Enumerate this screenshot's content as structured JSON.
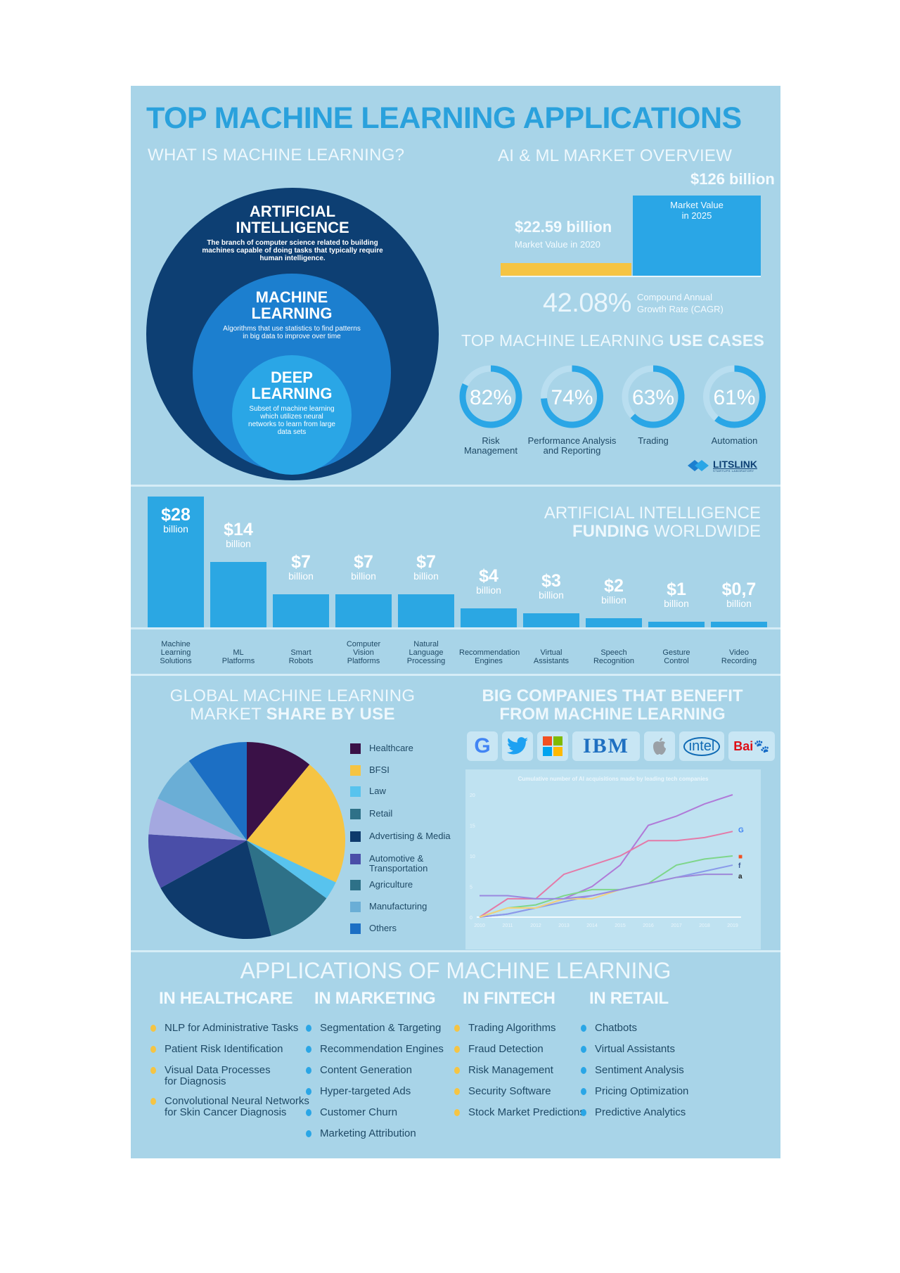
{
  "title": "TOP MACHINE LEARNING APPLICATIONS",
  "what_is": {
    "heading": "WHAT IS MACHINE LEARNING?",
    "circles": [
      {
        "title_line1": "ARTIFICIAL",
        "title_line2": "INTELLIGENCE",
        "desc": "The branch of computer science related to building machines capable of doing tasks that typically require human intelligence.",
        "color": "#0d3f73"
      },
      {
        "title_line1": "MACHINE",
        "title_line2": "LEARNING",
        "desc": "Algorithms that use statistics to find patterns in big data to improve over time",
        "color": "#1c7fcf"
      },
      {
        "title_line1": "DEEP",
        "title_line2": "LEARNING",
        "desc": "Subset of machine learning which utilizes neural networks to learn from large data sets",
        "color": "#2aa6e6"
      }
    ]
  },
  "market": {
    "heading": "AI & ML MARKET OVERVIEW",
    "value_2020": "$22.59 billion",
    "label_2020": "Market Value in 2020",
    "value_2025": "$126 billion",
    "label_2025_line1": "Market Value",
    "label_2025_line2": "in 2025",
    "cagr_value": "42.08%",
    "cagr_label_line1": "Compound Annual",
    "cagr_label_line2": "Growth Rate (CAGR)",
    "colors": {
      "2020": "#f5c443",
      "2025": "#2aa6e6"
    }
  },
  "use_cases": {
    "heading_light": "TOP MACHINE LEARNING ",
    "heading_bold": "USE CASES",
    "items": [
      {
        "pct": 82,
        "label": "82%",
        "name_line1": "Risk",
        "name_line2": "Management"
      },
      {
        "pct": 74,
        "label": "74%",
        "name_line1": "Performance Analysis",
        "name_line2": "and Reporting"
      },
      {
        "pct": 63,
        "label": "63%",
        "name_line1": "Trading",
        "name_line2": ""
      },
      {
        "pct": 61,
        "label": "61%",
        "name_line1": "Automation",
        "name_line2": ""
      }
    ],
    "brand": "LITSLINK",
    "brand_tagline": "STARTUPS LABORATORY"
  },
  "chart_data": [
    {
      "type": "bar",
      "title": "ARTIFICIAL INTELLIGENCE FUNDING WORLDWIDE",
      "title_line1": "ARTIFICIAL INTELLIGENCE",
      "title_line2_bold": "FUNDING",
      "title_line2_light": " WORLDWIDE",
      "unit_label": "billion",
      "categories": [
        "Machine Learning Solutions",
        "ML Platforms",
        "Smart Robots",
        "Computer Vision Platforms",
        "Natural Language Processing",
        "Recommendation Engines",
        "Virtual Assistants",
        "Speech Recognition",
        "Gesture Control",
        "Video Recording"
      ],
      "category_lines": [
        [
          "Machine",
          "Learning",
          "Solutions"
        ],
        [
          "ML",
          "Platforms"
        ],
        [
          "Smart",
          "Robots"
        ],
        [
          "Computer",
          "Vision",
          "Platforms"
        ],
        [
          "Natural",
          "Language",
          "Processing"
        ],
        [
          "Recommendation",
          "Engines"
        ],
        [
          "Virtual",
          "Assistants"
        ],
        [
          "Speech",
          "Recognition"
        ],
        [
          "Gesture",
          "Control"
        ],
        [
          "Video",
          "Recording"
        ]
      ],
      "values": [
        28,
        14,
        7,
        7,
        7,
        4,
        3,
        2,
        1,
        0.7
      ],
      "value_labels": [
        "$28",
        "$14",
        "$7",
        "$7",
        "$7",
        "$4",
        "$3",
        "$2",
        "$1",
        "$0,7"
      ],
      "ylabel": "USD billion"
    },
    {
      "type": "pie",
      "title": "GLOBAL MACHINE LEARNING MARKET SHARE BY USE",
      "title_line1": "GLOBAL MACHINE LEARNING",
      "title_line2_light": "MARKET ",
      "title_line2_bold": "SHARE BY USE",
      "legend_position": "right",
      "slices": [
        {
          "label": "Healthcare",
          "value": 11,
          "color": "#3a1147"
        },
        {
          "label": "BFSI",
          "value": 21,
          "color": "#f5c443"
        },
        {
          "label": "Law",
          "value": 3,
          "color": "#58c3ee"
        },
        {
          "label": "Retail",
          "value": 11,
          "color": "#2e7188"
        },
        {
          "label": "Advertising & Media",
          "value": 21,
          "color": "#0e3a6c"
        },
        {
          "label": "Automotive & Transportation",
          "value": 9,
          "color": "#4a4ea8"
        },
        {
          "label": "Agriculture",
          "value": 0,
          "color": "#2e7188"
        },
        {
          "label": "Manufacturing",
          "value": 0,
          "color": "#6aaed6"
        },
        {
          "label": "Others",
          "value": 0,
          "color": "#1c6fc4"
        }
      ],
      "drawn_slices": [
        {
          "label": "Healthcare",
          "value": 11,
          "color": "#3a1147"
        },
        {
          "label": "BFSI",
          "value": 21,
          "color": "#f5c443"
        },
        {
          "label": "Law",
          "value": 3,
          "color": "#58c3ee"
        },
        {
          "label": "Retail",
          "value": 11,
          "color": "#2e7188"
        },
        {
          "label": "Advertising & Media",
          "value": 21,
          "color": "#0e3a6c"
        },
        {
          "label": "Automotive & Transportation",
          "value": 9,
          "color": "#4a4ea8"
        },
        {
          "label": "Lavender segment",
          "value": 6,
          "color": "#a4a8e0"
        },
        {
          "label": "Manufacturing",
          "value": 8,
          "color": "#6aaed6"
        },
        {
          "label": "Others",
          "value": 10,
          "color": "#1c6fc4"
        }
      ],
      "legend_lines": [
        [
          "Healthcare"
        ],
        [
          "BFSI"
        ],
        [
          "Law"
        ],
        [
          "Retail"
        ],
        [
          "Advertising & Media"
        ],
        [
          "Automotive &",
          "Transportation"
        ],
        [
          "Agriculture"
        ],
        [
          "Manufacturing"
        ],
        [
          "Others"
        ]
      ]
    },
    {
      "type": "line",
      "title": "Cumulative number of AI acquisitions made by leading tech companies",
      "x": [
        2010,
        2011,
        2012,
        2013,
        2014,
        2015,
        2016,
        2017,
        2018,
        2019
      ],
      "ylim": [
        0,
        20
      ],
      "yticks": [
        0,
        5,
        10,
        15,
        20
      ],
      "series": [
        {
          "name": "Apple",
          "color": "#b07ad8",
          "values": [
            0,
            0.5,
            1.5,
            3,
            5,
            8.5,
            15,
            16.5,
            18.5,
            20
          ]
        },
        {
          "name": "Google",
          "color": "#e47aa8",
          "values": [
            0,
            3,
            3,
            7,
            8.5,
            10,
            12.5,
            12.5,
            13,
            14
          ]
        },
        {
          "name": "Microsoft",
          "color": "#7ed68a",
          "values": [
            0,
            1.5,
            2,
            3.5,
            4.5,
            4.5,
            5.5,
            8.5,
            9.5,
            10
          ]
        },
        {
          "name": "Facebook",
          "color": "#8a9aea",
          "values": [
            0,
            0.5,
            1.5,
            2.5,
            3.5,
            4.5,
            5.5,
            6.5,
            7.5,
            8.5
          ]
        },
        {
          "name": "Amazon",
          "color": "#f3d27a",
          "values": [
            0,
            1.5,
            1.5,
            3,
            3,
            4.5,
            5.5,
            6.5,
            7,
            7
          ]
        },
        {
          "name": "Intel",
          "color": "#9a88e0",
          "values": [
            3.5,
            3.5,
            3,
            3,
            3.5,
            4.5,
            5.5,
            6.5,
            7,
            7
          ]
        }
      ],
      "end_markers": [
        "apple-icon",
        "google-icon",
        "microsoft-icon",
        "facebook-icon",
        "amazon-icon"
      ]
    },
    {
      "type": "pie",
      "title": "Use case donut gauges",
      "values": [
        82,
        74,
        63,
        61
      ]
    }
  ],
  "companies": {
    "heading_line1": "BIG COMPANIES THAT BENEFIT",
    "heading_line2": "FROM MACHINE LEARNING",
    "logos": [
      {
        "name": "google-logo",
        "text": "G",
        "color": "#4285f4"
      },
      {
        "name": "twitter-logo",
        "text": "🐦",
        "color": "#1da1f2"
      },
      {
        "name": "microsoft-logo",
        "text": "",
        "color": "#f25022"
      },
      {
        "name": "ibm-logo",
        "text": "IBM",
        "color": "#1f70c1"
      },
      {
        "name": "apple-logo",
        "text": "",
        "color": "#9aa0a6"
      },
      {
        "name": "intel-logo",
        "text": "intel",
        "color": "#0f6ab4"
      },
      {
        "name": "baidu-logo",
        "text": "Bai",
        "color": "#de0f17"
      }
    ]
  },
  "applications": {
    "heading": "APPLICATIONS OF MACHINE LEARNING",
    "columns": [
      {
        "heading": "IN HEALTHCARE",
        "dot_color": "#f5c443",
        "items": [
          [
            "NLP for Administrative Tasks"
          ],
          [
            "Patient Risk Identification"
          ],
          [
            "Visual Data Processes",
            "for Diagnosis"
          ],
          [
            "Convolutional Neural Networks",
            "for Skin Cancer Diagnosis"
          ]
        ]
      },
      {
        "heading": "IN MARKETING",
        "dot_color": "#2aa6e6",
        "items": [
          [
            "Segmentation & Targeting"
          ],
          [
            "Recommendation Engines"
          ],
          [
            "Content Generation"
          ],
          [
            "Hyper-targeted Ads"
          ],
          [
            "Customer Churn"
          ],
          [
            "Marketing Attribution"
          ]
        ]
      },
      {
        "heading": "IN FINTECH",
        "dot_color": "#f5c443",
        "items": [
          [
            "Trading Algorithms"
          ],
          [
            "Fraud Detection"
          ],
          [
            "Risk Management"
          ],
          [
            "Security Software"
          ],
          [
            "Stock Market Predictions"
          ]
        ]
      },
      {
        "heading": "IN RETAIL",
        "dot_color": "#2aa6e6",
        "items": [
          [
            "Chatbots"
          ],
          [
            "Virtual Assistants"
          ],
          [
            "Sentiment Analysis"
          ],
          [
            "Pricing Optimization"
          ],
          [
            "Predictive Analytics"
          ]
        ]
      }
    ]
  }
}
